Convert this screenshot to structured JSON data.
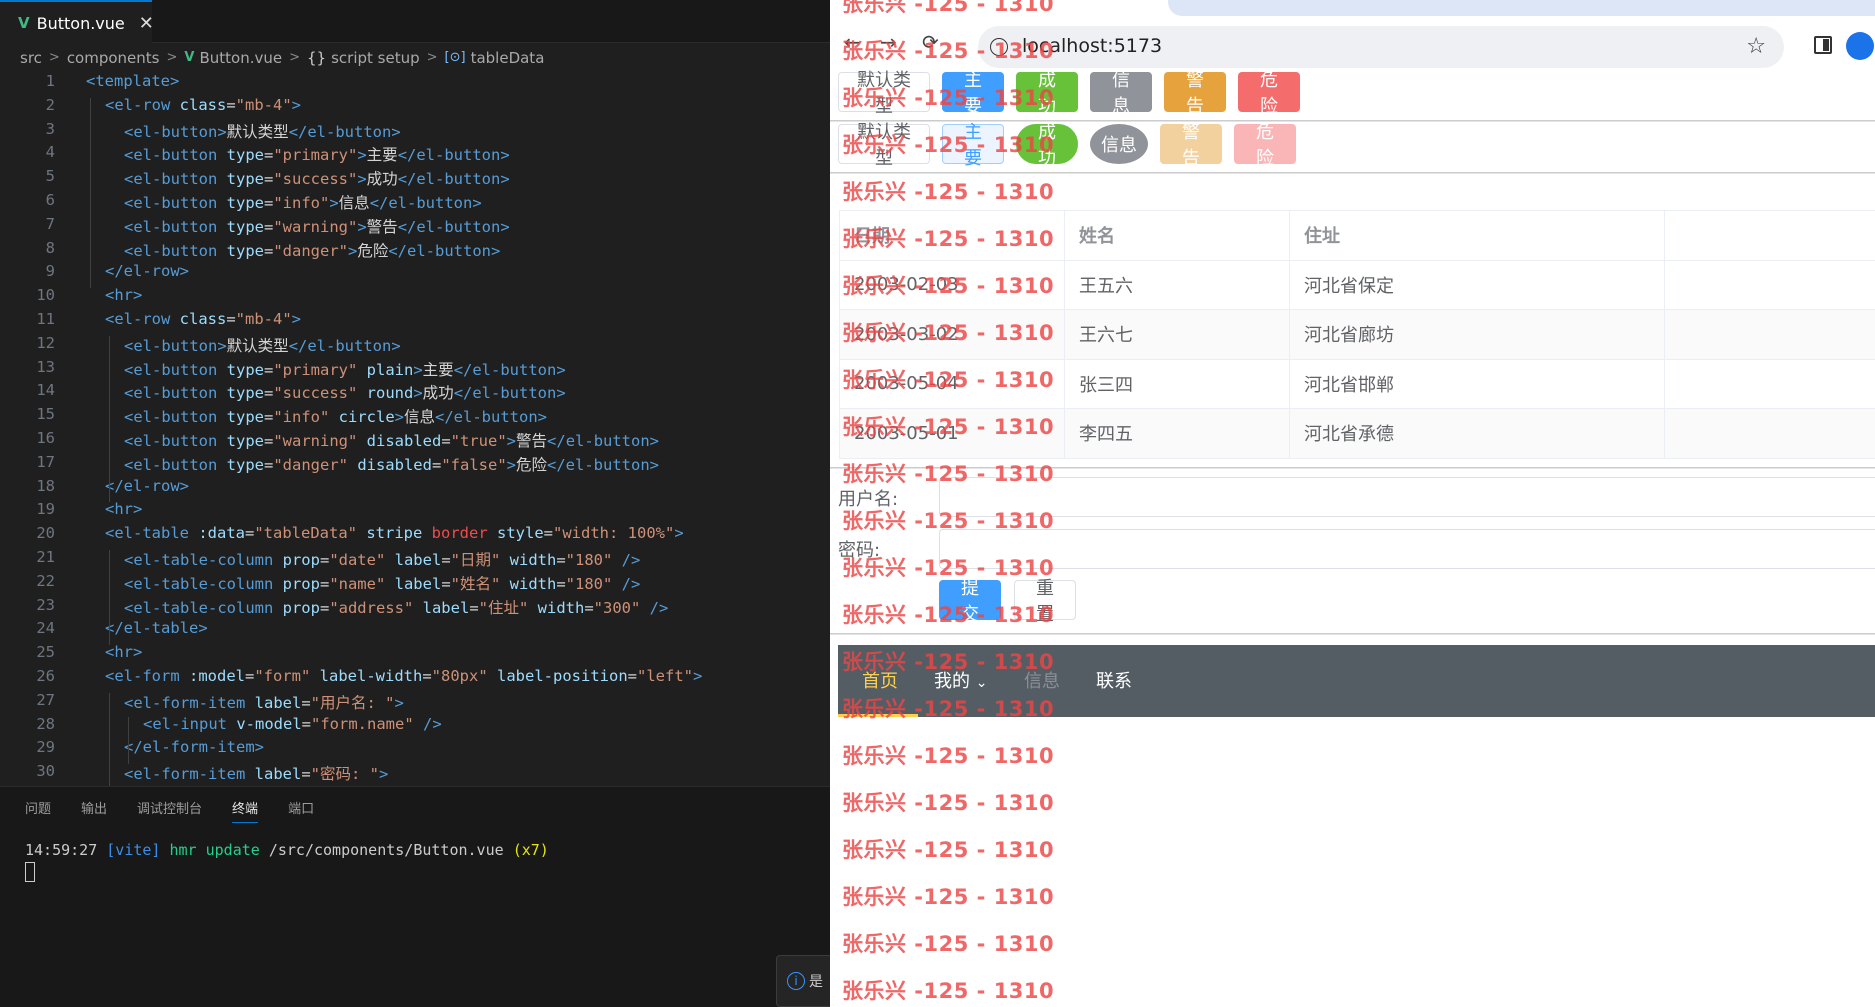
{
  "editor": {
    "tab": {
      "filename": "Button.vue",
      "close": "✕",
      "vue_mark": "V"
    },
    "breadcrumb": {
      "p1": "src",
      "p2": "components",
      "p3": "Button.vue",
      "p4": "script setup",
      "p5": "tableData",
      "brace": "{}"
    },
    "line_numbers": [
      "1",
      "2",
      "3",
      "4",
      "5",
      "6",
      "7",
      "8",
      "9",
      "10",
      "11",
      "12",
      "13",
      "14",
      "15",
      "16",
      "17",
      "18",
      "19",
      "20",
      "21",
      "22",
      "23",
      "24",
      "25",
      "26",
      "27",
      "28",
      "29",
      "30"
    ],
    "code": [
      [
        [
          "t",
          "<template>"
        ]
      ],
      [
        [
          "t",
          "<el-row "
        ],
        [
          "a",
          "class"
        ],
        [
          "x",
          "="
        ],
        [
          "s",
          "\"mb-4\""
        ],
        [
          "t",
          ">"
        ]
      ],
      [
        [
          "t",
          "<el-button"
        ],
        [
          "t",
          ">"
        ],
        [
          "x",
          "默认类型"
        ],
        [
          "t",
          "</el-button>"
        ]
      ],
      [
        [
          "t",
          "<el-button "
        ],
        [
          "a",
          "type"
        ],
        [
          "x",
          "="
        ],
        [
          "s",
          "\"primary\""
        ],
        [
          "t",
          ">"
        ],
        [
          "x",
          "主要"
        ],
        [
          "t",
          "</el-button>"
        ]
      ],
      [
        [
          "t",
          "<el-button "
        ],
        [
          "a",
          "type"
        ],
        [
          "x",
          "="
        ],
        [
          "s",
          "\"success\""
        ],
        [
          "t",
          ">"
        ],
        [
          "x",
          "成功"
        ],
        [
          "t",
          "</el-button>"
        ]
      ],
      [
        [
          "t",
          "<el-button "
        ],
        [
          "a",
          "type"
        ],
        [
          "x",
          "="
        ],
        [
          "s",
          "\"info\""
        ],
        [
          "t",
          ">"
        ],
        [
          "x",
          "信息"
        ],
        [
          "t",
          "</el-button>"
        ]
      ],
      [
        [
          "t",
          "<el-button "
        ],
        [
          "a",
          "type"
        ],
        [
          "x",
          "="
        ],
        [
          "s",
          "\"warning\""
        ],
        [
          "t",
          ">"
        ],
        [
          "x",
          "警告"
        ],
        [
          "t",
          "</el-button>"
        ]
      ],
      [
        [
          "t",
          "<el-button "
        ],
        [
          "a",
          "type"
        ],
        [
          "x",
          "="
        ],
        [
          "s",
          "\"danger\""
        ],
        [
          "t",
          ">"
        ],
        [
          "x",
          "危险"
        ],
        [
          "t",
          "</el-button>"
        ]
      ],
      [
        [
          "t",
          "</el-row>"
        ]
      ],
      [
        [
          "t",
          "<hr>"
        ]
      ],
      [
        [
          "t",
          "<el-row "
        ],
        [
          "a",
          "class"
        ],
        [
          "x",
          "="
        ],
        [
          "s",
          "\"mb-4\""
        ],
        [
          "t",
          ">"
        ]
      ],
      [
        [
          "t",
          "<el-button"
        ],
        [
          "t",
          ">"
        ],
        [
          "x",
          "默认类型"
        ],
        [
          "t",
          "</el-button>"
        ]
      ],
      [
        [
          "t",
          "<el-button "
        ],
        [
          "a",
          "type"
        ],
        [
          "x",
          "="
        ],
        [
          "s",
          "\"primary\""
        ],
        [
          "a",
          " plain"
        ],
        [
          "t",
          ">"
        ],
        [
          "x",
          "主要"
        ],
        [
          "t",
          "</el-button>"
        ]
      ],
      [
        [
          "t",
          "<el-button "
        ],
        [
          "a",
          "type"
        ],
        [
          "x",
          "="
        ],
        [
          "s",
          "\"success\""
        ],
        [
          "a",
          " round"
        ],
        [
          "t",
          ">"
        ],
        [
          "x",
          "成功"
        ],
        [
          "t",
          "</el-button>"
        ]
      ],
      [
        [
          "t",
          "<el-button "
        ],
        [
          "a",
          "type"
        ],
        [
          "x",
          "="
        ],
        [
          "s",
          "\"info\""
        ],
        [
          "a",
          " circle"
        ],
        [
          "t",
          ">"
        ],
        [
          "x",
          "信息"
        ],
        [
          "t",
          "</el-button>"
        ]
      ],
      [
        [
          "t",
          "<el-button "
        ],
        [
          "a",
          "type"
        ],
        [
          "x",
          "="
        ],
        [
          "s",
          "\"warning\""
        ],
        [
          "a",
          " disabled"
        ],
        [
          "x",
          "="
        ],
        [
          "s",
          "\"true\""
        ],
        [
          "t",
          ">"
        ],
        [
          "x",
          "警告"
        ],
        [
          "t",
          "</el-button>"
        ]
      ],
      [
        [
          "t",
          "<el-button "
        ],
        [
          "a",
          "type"
        ],
        [
          "x",
          "="
        ],
        [
          "s",
          "\"danger\""
        ],
        [
          "a",
          " disabled"
        ],
        [
          "x",
          "="
        ],
        [
          "s",
          "\"false\""
        ],
        [
          "t",
          ">"
        ],
        [
          "x",
          "危险"
        ],
        [
          "t",
          "</el-button>"
        ]
      ],
      [
        [
          "t",
          "</el-row>"
        ]
      ],
      [
        [
          "t",
          "<hr>"
        ]
      ],
      [
        [
          "t",
          "<el-table "
        ],
        [
          "a",
          ":data"
        ],
        [
          "x",
          "="
        ],
        [
          "s",
          "\"tableData\""
        ],
        [
          "a",
          " stripe "
        ],
        [
          "r",
          "border"
        ],
        [
          "a",
          " style"
        ],
        [
          "x",
          "="
        ],
        [
          "s",
          "\"width: 100%\""
        ],
        [
          "t",
          ">"
        ]
      ],
      [
        [
          "t",
          "<el-table-column "
        ],
        [
          "a",
          "prop"
        ],
        [
          "x",
          "="
        ],
        [
          "s",
          "\"date\""
        ],
        [
          "a",
          " label"
        ],
        [
          "x",
          "="
        ],
        [
          "s",
          "\"日期\""
        ],
        [
          "a",
          " width"
        ],
        [
          "x",
          "="
        ],
        [
          "s",
          "\"180\""
        ],
        [
          "t",
          " />"
        ]
      ],
      [
        [
          "t",
          "<el-table-column "
        ],
        [
          "a",
          "prop"
        ],
        [
          "x",
          "="
        ],
        [
          "s",
          "\"name\""
        ],
        [
          "a",
          " label"
        ],
        [
          "x",
          "="
        ],
        [
          "s",
          "\"姓名\""
        ],
        [
          "a",
          " width"
        ],
        [
          "x",
          "="
        ],
        [
          "s",
          "\"180\""
        ],
        [
          "t",
          " />"
        ]
      ],
      [
        [
          "t",
          "<el-table-column "
        ],
        [
          "a",
          "prop"
        ],
        [
          "x",
          "="
        ],
        [
          "s",
          "\"address\""
        ],
        [
          "a",
          " label"
        ],
        [
          "x",
          "="
        ],
        [
          "s",
          "\"住址\""
        ],
        [
          "a",
          " width"
        ],
        [
          "x",
          "="
        ],
        [
          "s",
          "\"300\""
        ],
        [
          "t",
          " />"
        ]
      ],
      [
        [
          "t",
          "</el-table>"
        ]
      ],
      [
        [
          "t",
          "<hr>"
        ]
      ],
      [
        [
          "t",
          "<el-form "
        ],
        [
          "a",
          ":model"
        ],
        [
          "x",
          "="
        ],
        [
          "s",
          "\"form\""
        ],
        [
          "a",
          " label-width"
        ],
        [
          "x",
          "="
        ],
        [
          "s",
          "\"80px\""
        ],
        [
          "a",
          " label-position"
        ],
        [
          "x",
          "="
        ],
        [
          "s",
          "\"left\""
        ],
        [
          "t",
          ">"
        ]
      ],
      [
        [
          "t",
          "<el-form-item "
        ],
        [
          "a",
          "label"
        ],
        [
          "x",
          "="
        ],
        [
          "s",
          "\"用户名: \""
        ],
        [
          "t",
          ">"
        ]
      ],
      [
        [
          "t",
          "<el-input "
        ],
        [
          "a",
          "v-model"
        ],
        [
          "x",
          "="
        ],
        [
          "s",
          "\"form.name\""
        ],
        [
          "t",
          " />"
        ]
      ],
      [
        [
          "t",
          "</el-form-item>"
        ]
      ],
      [
        [
          "t",
          "<el-form-item "
        ],
        [
          "a",
          "label"
        ],
        [
          "x",
          "="
        ],
        [
          "s",
          "\"密码: \""
        ],
        [
          "t",
          ">"
        ]
      ]
    ],
    "panel_tabs": [
      "问题",
      "输出",
      "调试控制台",
      "终端",
      "端口"
    ],
    "terminal": {
      "time": "14:59:27",
      "vite": "[vite]",
      "hmr": "hmr update",
      "path": "/src/components/Button.vue",
      "count": "(x7)"
    },
    "notification": "是"
  },
  "browser": {
    "nav": {
      "back": "←",
      "forward": "→",
      "reload": "⟳"
    },
    "url": "localhost:5173",
    "star": "☆",
    "row1": [
      "默认类型",
      "主要",
      "成功",
      "信息",
      "警告",
      "危险"
    ],
    "row2": [
      "默认类型",
      "主要",
      "成功",
      "信息",
      "警告",
      "危险"
    ],
    "table": {
      "headers": [
        "日期",
        "姓名",
        "住址"
      ],
      "rows": [
        [
          "2003-02-03",
          "王五六",
          "河北省保定"
        ],
        [
          "2003-03-02",
          "王六七",
          "河北省廊坊"
        ],
        [
          "2003-05-04",
          "张三四",
          "河北省邯郸"
        ],
        [
          "2003-05-01",
          "李四五",
          "河北省承德"
        ]
      ]
    },
    "form": {
      "username_label": "用户名:",
      "password_label": "密码:",
      "submit": "提交",
      "reset": "重置"
    },
    "menu": {
      "home": "首页",
      "mine": "我的",
      "mine_caret": "⌄",
      "info": "信息",
      "contact": "联系"
    },
    "watermark": "张乐兴 -125 - 1310"
  }
}
